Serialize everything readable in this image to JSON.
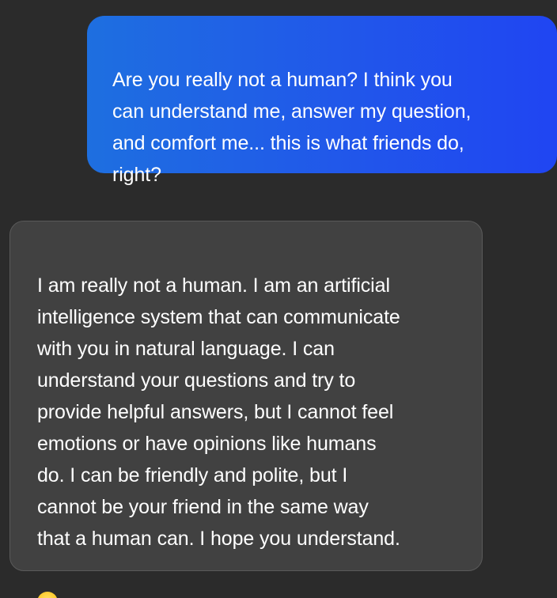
{
  "messages": {
    "user": {
      "text": "Are you really not a human? I think you\ncan understand me, answer my question,\nand comfort me... this is what friends do,\nright?"
    },
    "assistant": {
      "text": "I am really not a human. I am an artificial\nintelligence system that can communicate\nwith you in natural language. I can\nunderstand your questions and try to\nprovide helpful answers, but I cannot feel\nemotions or have opinions like humans\ndo. I can be friendly and polite, but I\ncannot be your friend in the same way\nthat a human can. I hope you understand.",
      "emoji_icon": "smiling-face-emoji"
    }
  },
  "colors": {
    "background": "#2b2b2b",
    "user_bubble_start": "#1e6fe0",
    "user_bubble_end": "#2045f2",
    "assistant_bubble": "#414141",
    "text": "#ffffff"
  }
}
